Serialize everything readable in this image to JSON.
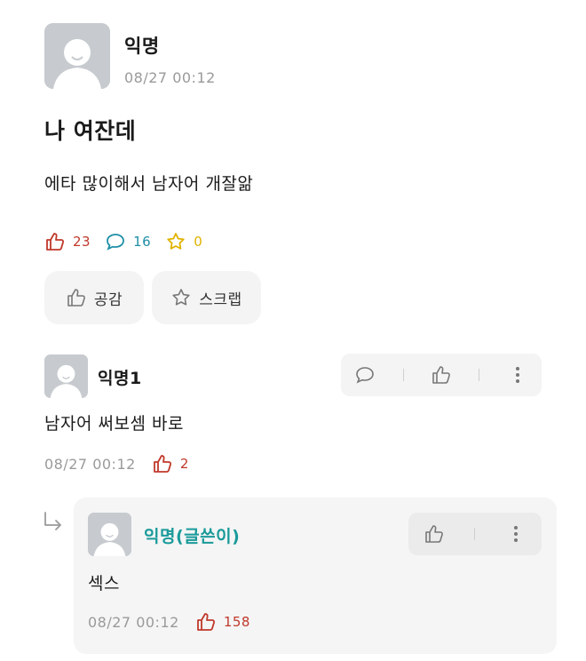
{
  "post": {
    "author": "익명",
    "timestamp": "08/27 00:12",
    "title": "나 여잔데",
    "body": "에타 많이해서 남자어 개잘앎",
    "stats": {
      "likes": "23",
      "comments": "16",
      "scraps": "0"
    },
    "buttons": {
      "like_label": "공감",
      "scrap_label": "스크랩"
    }
  },
  "comments": [
    {
      "author": "익명1",
      "text": "남자어 써보셈 바로",
      "timestamp": "08/27 00:12",
      "likes": "2",
      "replies": [
        {
          "author": "익명(글쓴이)",
          "text": "섹스",
          "timestamp": "08/27 00:12",
          "likes": "158"
        }
      ]
    }
  ],
  "colors": {
    "like_red": "#c0392b",
    "comment_teal": "#1f8fa6",
    "scrap_gold": "#e0b300",
    "author_op_teal": "#1a9a9a",
    "time_gray": "#9a9a9a"
  }
}
